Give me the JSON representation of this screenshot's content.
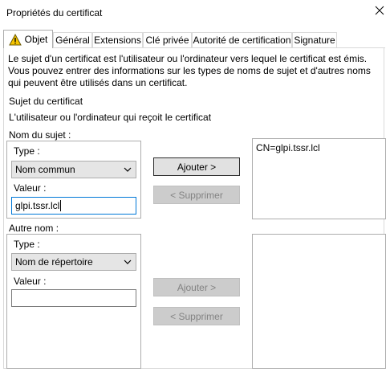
{
  "window": {
    "title": "Propriétés du certificat",
    "close_icon": "close-icon"
  },
  "tabs": [
    {
      "label": "Objet",
      "icon": "warning-icon",
      "active": true
    },
    {
      "label": "Général"
    },
    {
      "label": "Extensions"
    },
    {
      "label": "Clé privée"
    },
    {
      "label": "Autorité de certification"
    },
    {
      "label": "Signature"
    }
  ],
  "description": "Le sujet d'un certificat est l'utilisateur ou l'ordinateur vers lequel le certificat est émis. Vous pouvez entrer des informations sur les types de noms de sujet et d'autres noms qui peuvent être utilisés dans un certificat.",
  "subject_section": {
    "title": "Sujet du certificat",
    "subtitle": "L'utilisateur ou l'ordinateur qui reçoit le certificat"
  },
  "subject_name": {
    "label": "Nom du sujet :",
    "type_label": "Type :",
    "type_value": "Nom commun",
    "value_label": "Valeur :",
    "value_input": "glpi.tssr.lcl",
    "add_button": "Ajouter >",
    "remove_button": "< Supprimer",
    "list_items": [
      "CN=glpi.tssr.lcl"
    ]
  },
  "alt_name": {
    "label": "Autre nom :",
    "type_label": "Type :",
    "type_value": "Nom de répertoire",
    "value_label": "Valeur :",
    "value_input": "",
    "add_button": "Ajouter >",
    "remove_button": "< Supprimer"
  },
  "colors": {
    "focus_border": "#0078d7",
    "warning_yellow": "#f5c400"
  }
}
